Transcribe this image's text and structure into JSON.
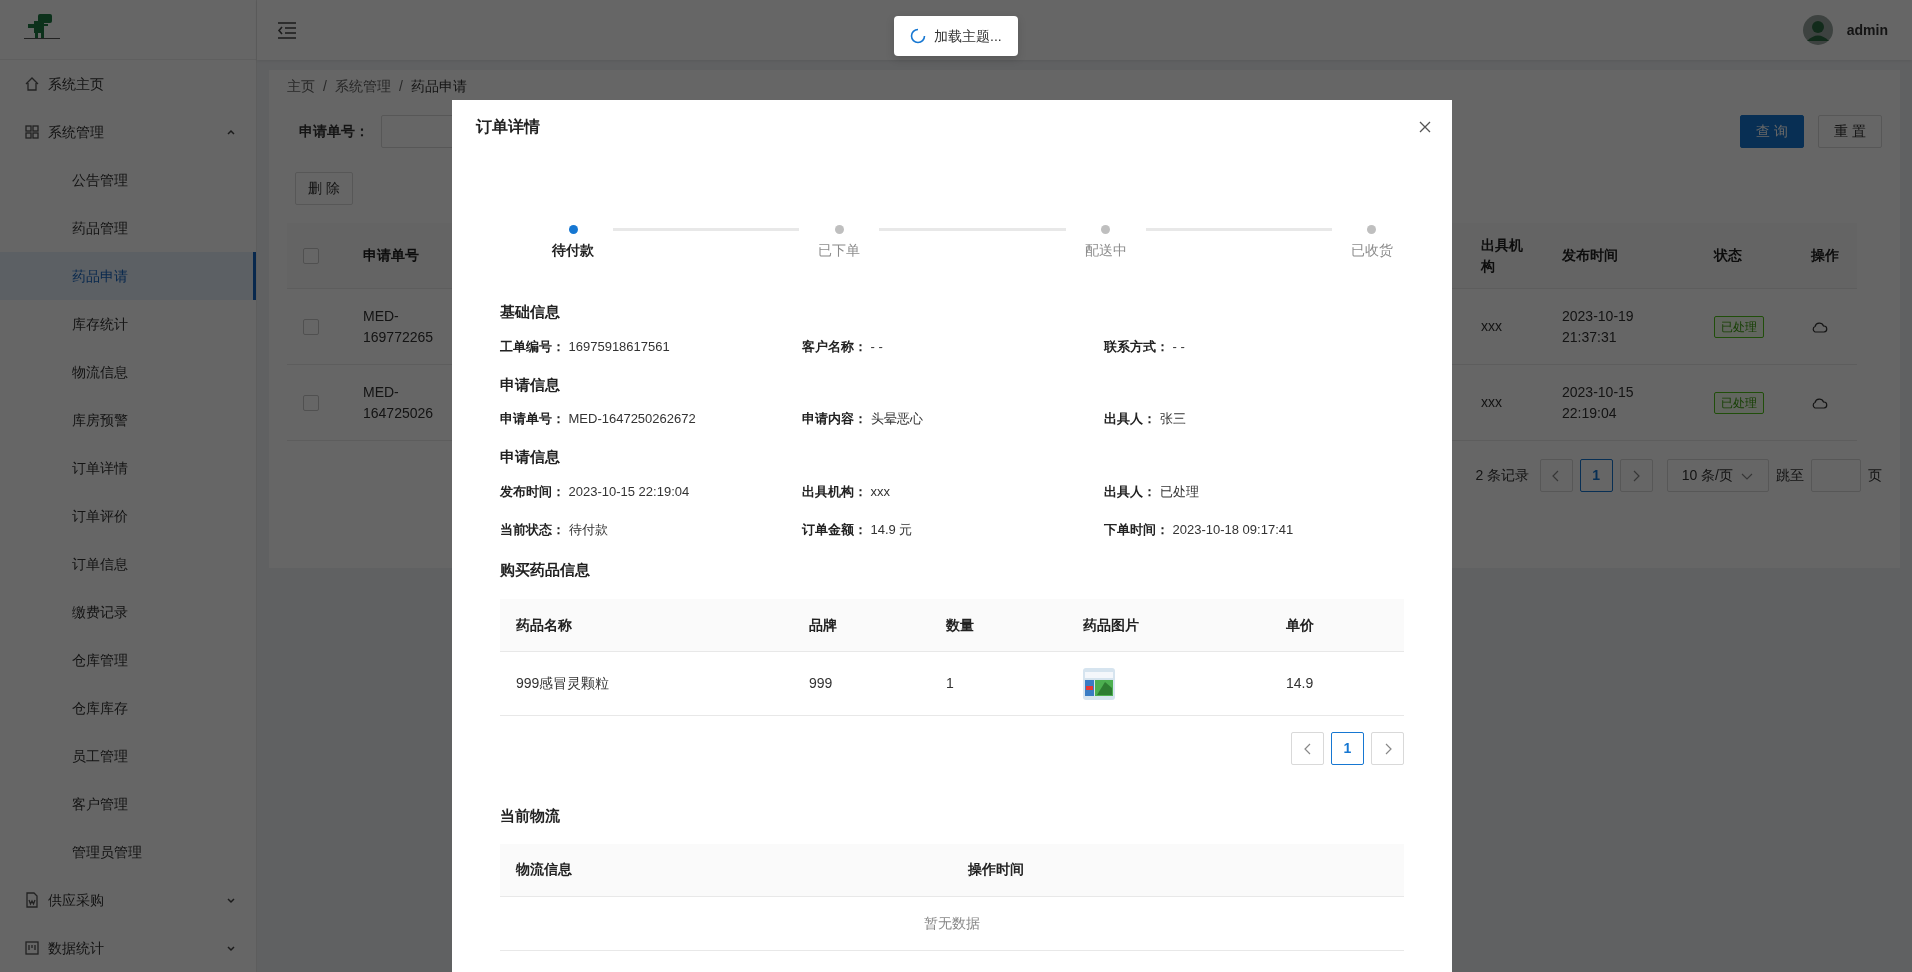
{
  "sidebar": {
    "items": [
      {
        "kind": "link",
        "label": "系统主页"
      },
      {
        "kind": "group",
        "label": "系统管理",
        "expanded": true,
        "children": [
          {
            "label": "公告管理",
            "selected": false
          },
          {
            "label": "药品管理",
            "selected": false
          },
          {
            "label": "药品申请",
            "selected": true
          },
          {
            "label": "库存统计",
            "selected": false
          },
          {
            "label": "物流信息",
            "selected": false
          },
          {
            "label": "库房预警",
            "selected": false
          },
          {
            "label": "订单详情",
            "selected": false
          },
          {
            "label": "订单评价",
            "selected": false
          },
          {
            "label": "订单信息",
            "selected": false
          },
          {
            "label": "缴费记录",
            "selected": false
          },
          {
            "label": "仓库管理",
            "selected": false
          },
          {
            "label": "仓库库存",
            "selected": false
          },
          {
            "label": "员工管理",
            "selected": false
          },
          {
            "label": "客户管理",
            "selected": false
          },
          {
            "label": "管理员管理",
            "selected": false
          }
        ]
      },
      {
        "kind": "group",
        "label": "供应采购",
        "expanded": false
      },
      {
        "kind": "group",
        "label": "数据统计",
        "expanded": false
      }
    ]
  },
  "header": {
    "user": "admin",
    "toast": "加载主题..."
  },
  "breadcrumb": {
    "separator": "/",
    "items": [
      "主页",
      "系统管理",
      "药品申请"
    ]
  },
  "search": {
    "label": "申请单号：",
    "buttons": [
      {
        "label": "查 询",
        "kind": "primary"
      },
      {
        "label": "重 置",
        "kind": "default"
      }
    ]
  },
  "delete_button": "删 除",
  "table": {
    "header_checked": false,
    "columns_left": [
      "申请单号"
    ],
    "columns_right": [
      "出具机构",
      "发布时间",
      "状态",
      "操作"
    ],
    "rows": [
      {
        "checked": false,
        "id": "MED-169772265",
        "org": "xxx",
        "time": "2023-10-19 21:37:31",
        "status": "已处理"
      },
      {
        "checked": false,
        "id": "MED-164725026",
        "org": "xxx",
        "time": "2023-10-15 22:19:04",
        "status": "已处理"
      }
    ]
  },
  "pagination": {
    "total": "2 条记录",
    "pages": [
      {
        "label": "1",
        "selected": true
      }
    ],
    "page_size": "10 条/页",
    "jump": "跳至",
    "suffix": "页"
  },
  "modal": {
    "title": "订单详情",
    "steps": [
      {
        "label": "待付款",
        "selected": true
      },
      {
        "label": "已下单",
        "selected": false
      },
      {
        "label": "配送中",
        "selected": false
      },
      {
        "label": "已收货",
        "selected": false
      }
    ],
    "sections": [
      {
        "title": "基础信息",
        "fields": [
          {
            "label": "工单编号：",
            "value": "16975918617561"
          },
          {
            "label": "客户名称：",
            "value": "- -"
          },
          {
            "label": "联系方式：",
            "value": "- -"
          }
        ]
      },
      {
        "title": "申请信息",
        "fields": [
          {
            "label": "申请单号：",
            "value": "MED-1647250262672"
          },
          {
            "label": "申请内容：",
            "value": "头晕恶心"
          },
          {
            "label": "出具人：",
            "value": "张三"
          }
        ]
      },
      {
        "title": "申请信息",
        "fields": [
          {
            "label": "发布时间：",
            "value": "2023-10-15 22:19:04"
          },
          {
            "label": "出具机构：",
            "value": "xxx"
          },
          {
            "label": "出具人：",
            "value": "已处理"
          },
          {
            "label": "当前状态：",
            "value": "待付款"
          },
          {
            "label": "订单金额：",
            "value": "14.9 元"
          },
          {
            "label": "下单时间：",
            "value": "2023-10-18 09:17:41"
          }
        ]
      }
    ],
    "products": {
      "title": "购买药品信息",
      "columns": [
        "药品名称",
        "品牌",
        "数量",
        "药品图片",
        "单价"
      ],
      "rows": [
        {
          "name": "999感冒灵颗粒",
          "brand": "999",
          "qty": "1",
          "price": "14.9"
        }
      ],
      "pages": [
        {
          "label": "1",
          "selected": true
        }
      ]
    },
    "logistics": {
      "title": "当前物流",
      "columns": [
        "物流信息",
        "操作时间"
      ],
      "empty": "暂无数据"
    }
  }
}
